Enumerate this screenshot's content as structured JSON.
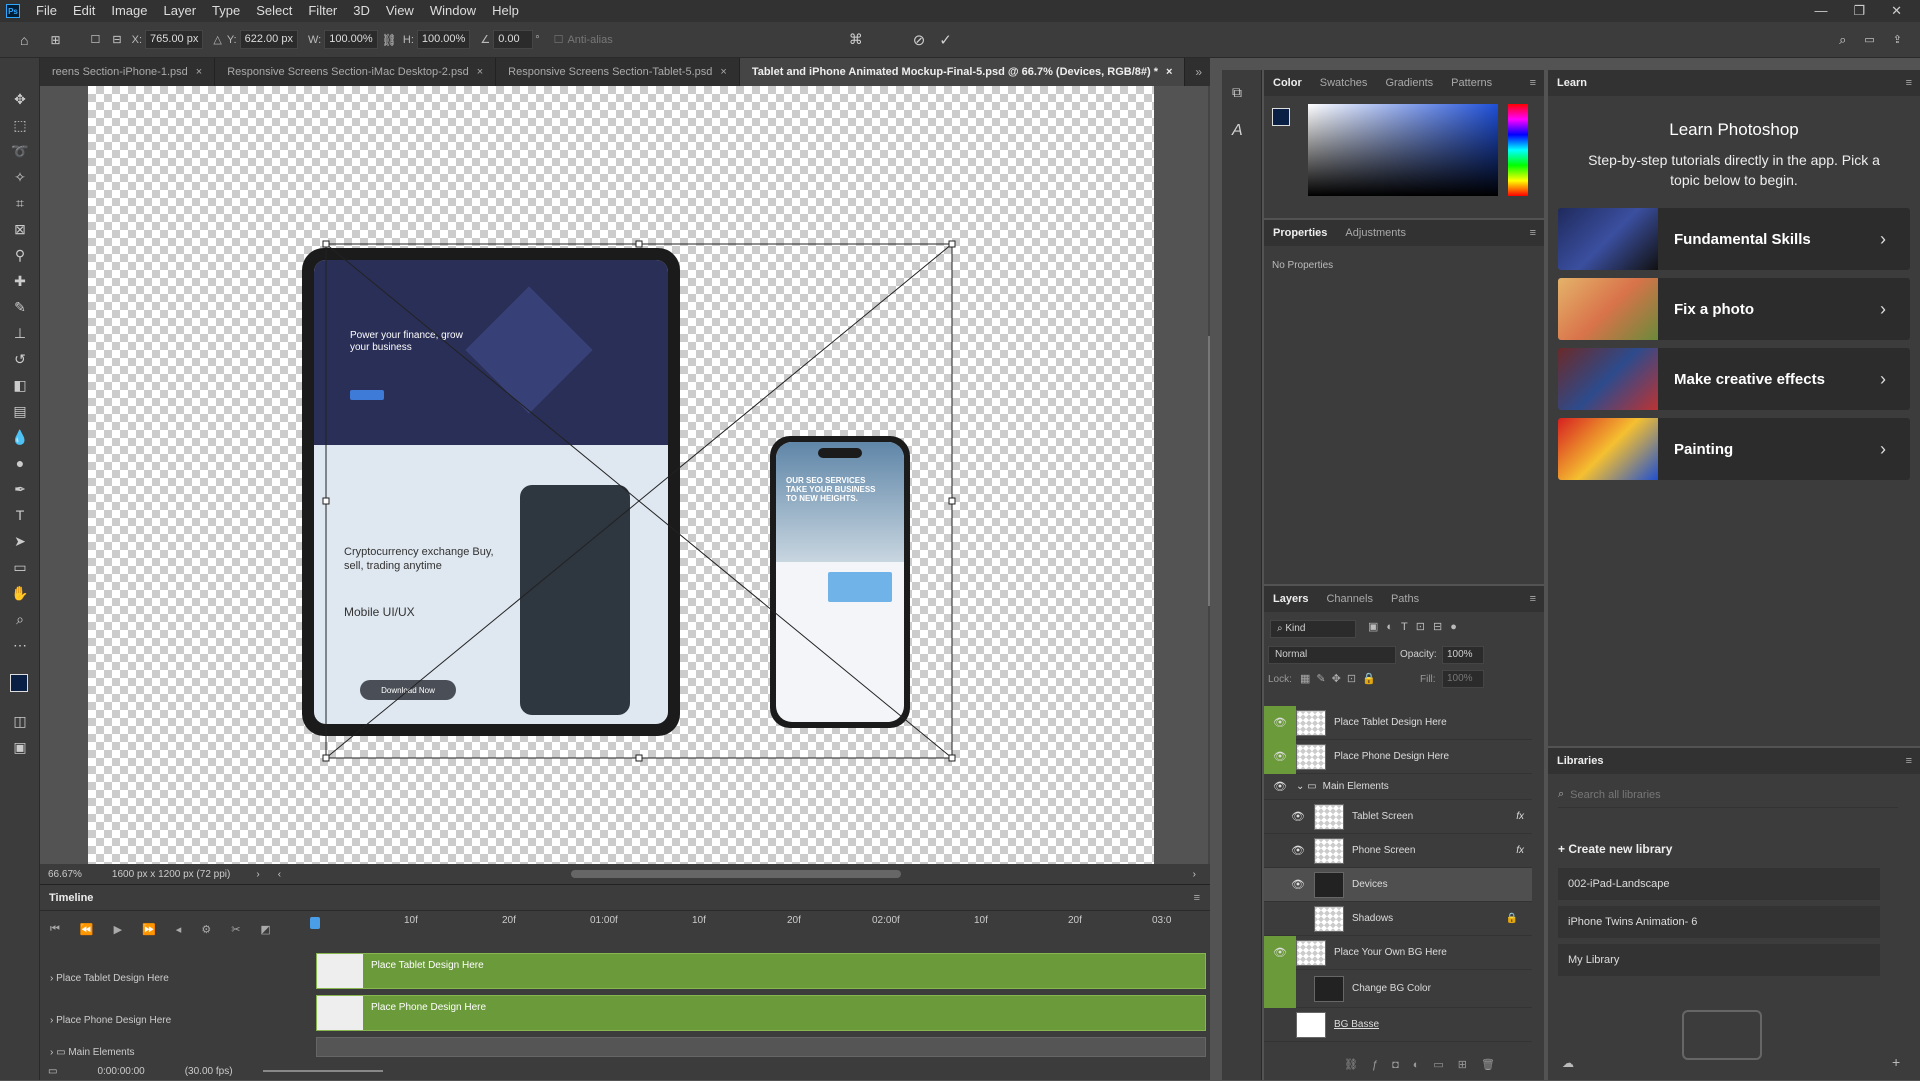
{
  "menu": [
    "File",
    "Edit",
    "Image",
    "Layer",
    "Type",
    "Select",
    "Filter",
    "3D",
    "View",
    "Window",
    "Help"
  ],
  "app_logo": "Ps",
  "options": {
    "x_label": "X:",
    "x_value": "765.00 px",
    "y_label": "Y:",
    "y_value": "622.00 px",
    "w_label": "W:",
    "w_value": "100.00%",
    "h_label": "H:",
    "h_value": "100.00%",
    "angle_value": "0.00",
    "deg": "°",
    "antialias": "Anti-alias"
  },
  "tabs": [
    {
      "label": "reens Section-iPhone-1.psd"
    },
    {
      "label": "Responsive Screens Section-iMac Desktop-2.psd"
    },
    {
      "label": "Responsive Screens Section-Tablet-5.psd"
    },
    {
      "label": "Tablet and iPhone Animated Mockup-Final-5.psd @ 66.7% (Devices, RGB/8#) *"
    }
  ],
  "tab_close": "×",
  "artwork": {
    "tablet_hero": "Power your finance, grow your business",
    "tablet_crypto": "Cryptocurrency exchange Buy, sell, trading anytime",
    "tablet_mobile": "Mobile UI/UX",
    "tablet_button": "Download Now",
    "phone_hero": "OUR SEO SERVICES TAKE YOUR BUSINESS TO NEW HEIGHTS."
  },
  "status": {
    "zoom": "66.67%",
    "doc_size": "1600 px x 1200 px (72 ppi)"
  },
  "timeline": {
    "title": "Timeline",
    "ruler": [
      "10f",
      "20f",
      "01:00f",
      "10f",
      "20f",
      "02:00f",
      "10f",
      "20f",
      "03:0"
    ],
    "tracks": [
      {
        "name": "Place Tablet Design Here",
        "clip": "Place Tablet Design Here"
      },
      {
        "name": "Place Phone Design Here",
        "clip": "Place Phone Design Here"
      }
    ],
    "group": "Main Elements",
    "time": "0:00:00:00",
    "fps": "(30.00 fps)"
  },
  "color_panel": {
    "tabs": [
      "Color",
      "Swatches",
      "Gradients",
      "Patterns"
    ]
  },
  "props_panel": {
    "tabs": [
      "Properties",
      "Adjustments"
    ],
    "empty": "No Properties"
  },
  "layers_panel": {
    "tabs": [
      "Layers",
      "Channels",
      "Paths"
    ],
    "kind": "Kind",
    "blend": "Normal",
    "opacity_label": "Opacity:",
    "opacity": "100%",
    "lock_label": "Lock:",
    "fill_label": "Fill:",
    "fill": "100%",
    "layers": [
      {
        "name": "Place Tablet Design Here"
      },
      {
        "name": "Place Phone Design Here"
      },
      {
        "name": "Main Elements"
      },
      {
        "name": "Tablet Screen"
      },
      {
        "name": "Phone Screen"
      },
      {
        "name": "Devices"
      },
      {
        "name": "Shadows"
      },
      {
        "name": "Place Your Own BG Here"
      },
      {
        "name": "Change BG Color"
      },
      {
        "name": "BG Basse"
      }
    ]
  },
  "learn": {
    "tab": "Learn",
    "title": "Learn Photoshop",
    "subtitle": "Step-by-step tutorials directly in the app. Pick a topic below to begin.",
    "cards": [
      {
        "label": "Fundamental Skills"
      },
      {
        "label": "Fix a photo"
      },
      {
        "label": "Make creative effects"
      },
      {
        "label": "Painting"
      }
    ]
  },
  "libraries": {
    "tab": "Libraries",
    "search_placeholder": "Search all libraries",
    "create": "Create new library",
    "items": [
      "002-iPad-Landscape",
      "iPhone Twins Animation- 6",
      "My Library"
    ]
  },
  "colors": {
    "accent": "#31a8ff",
    "track": "#6b9a3a",
    "fg": "#0a1f44"
  }
}
